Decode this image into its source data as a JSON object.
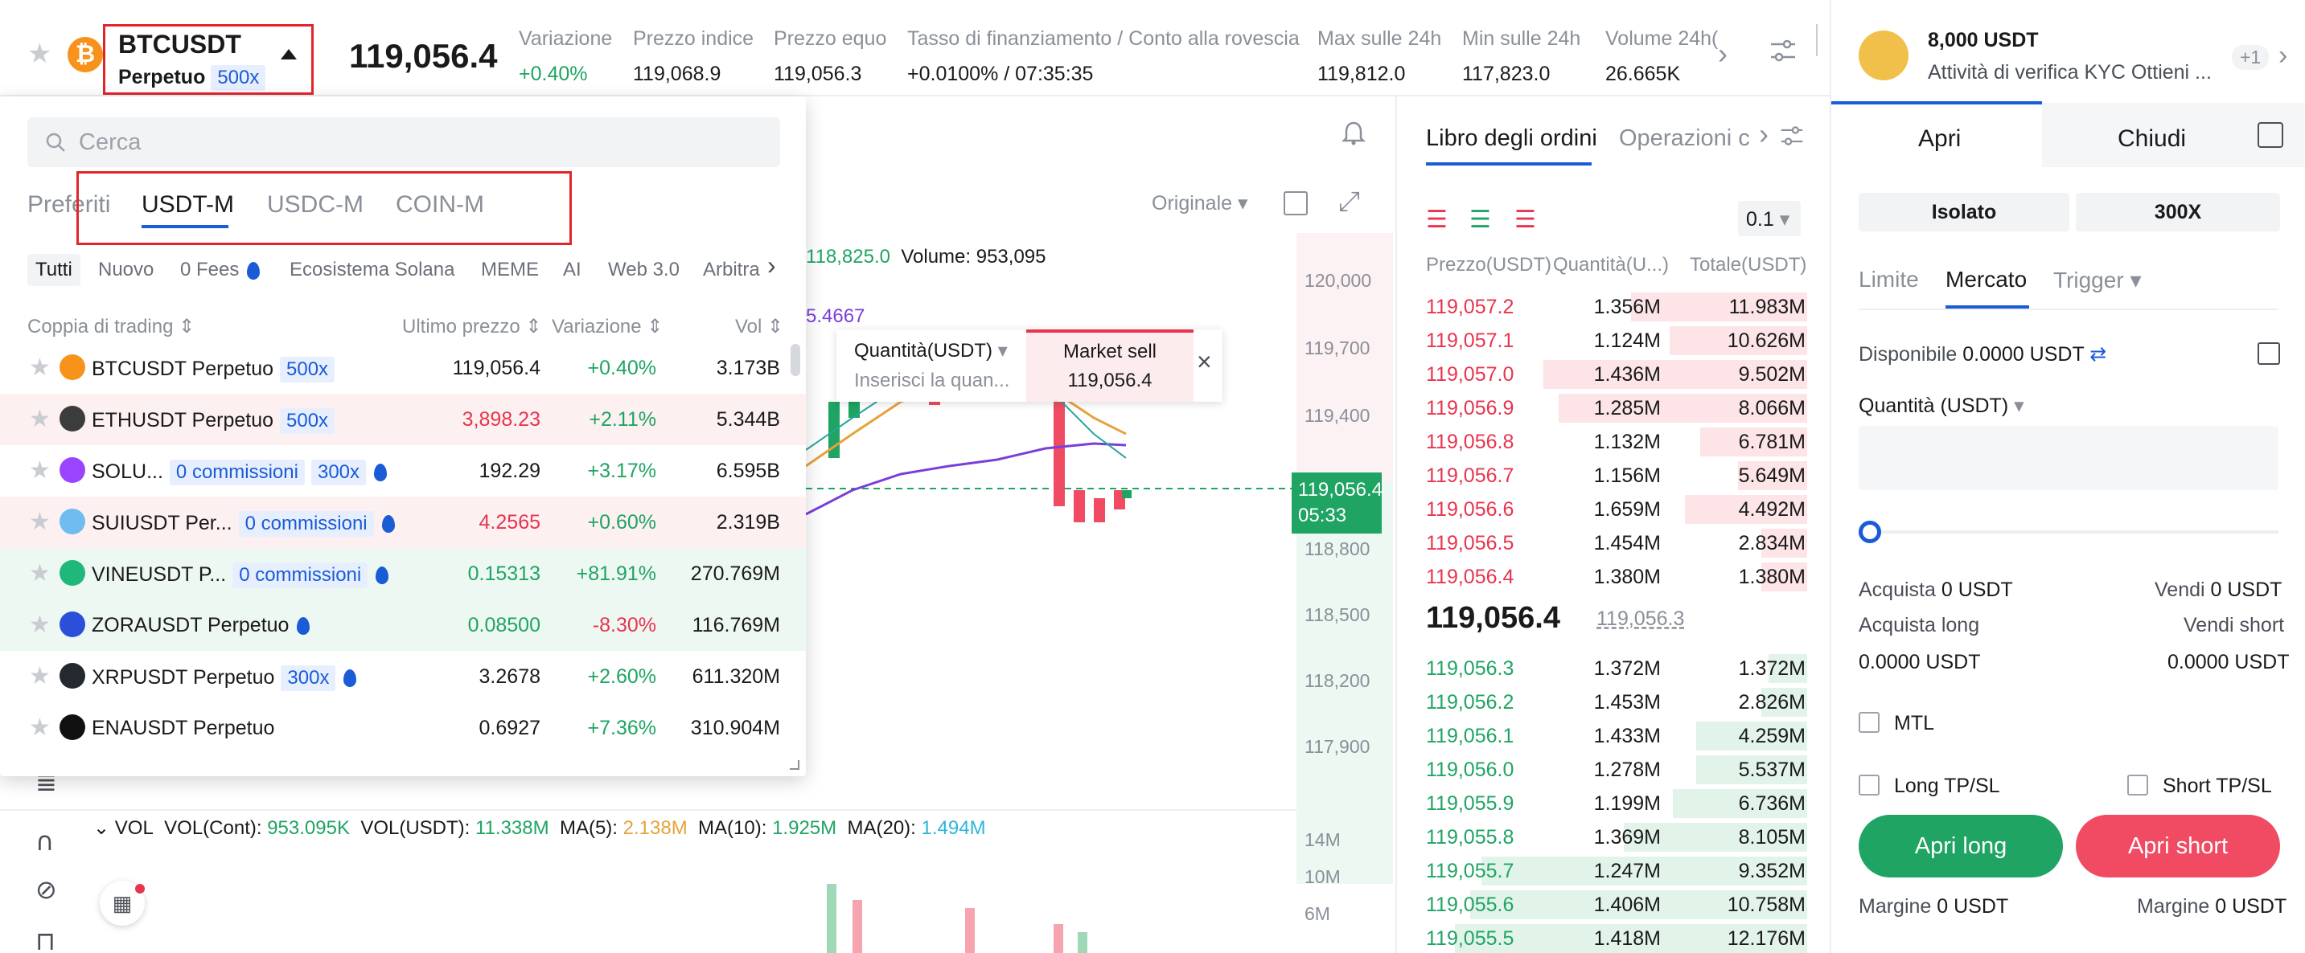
{
  "ticker": {
    "symbol": "BTCUSDT",
    "contract": "Perpetuo",
    "leverage": "500x",
    "last_price": "119,056.4",
    "stats": [
      {
        "label": "Variazione",
        "value": "+0.40%"
      },
      {
        "label": "Prezzo indice",
        "value": "119,068.9"
      },
      {
        "label": "Prezzo equo",
        "value": "119,056.3"
      },
      {
        "label": "Tasso di finanziamento",
        "label2": "Conto alla rovescia",
        "value": "+0.0100%",
        "value2": "07:35:35"
      },
      {
        "label": "Max sulle 24h",
        "value": "119,812.0"
      },
      {
        "label": "Min sulle 24h",
        "value": "117,823.0"
      },
      {
        "label": "Volume 24h(",
        "value": "26.665K"
      }
    ]
  },
  "dropdown": {
    "search_placeholder": "Cerca",
    "tabs": [
      "Preferiti",
      "USDT-M",
      "USDC-M",
      "COIN-M"
    ],
    "chips": [
      "Tutti",
      "Nuovo",
      "0 Fees",
      "Ecosistema Solana",
      "MEME",
      "AI",
      "Web 3.0",
      "Arbitra"
    ],
    "columns": [
      "Coppia di trading",
      "Ultimo prezzo",
      "Variazione",
      "Vol"
    ],
    "rows": [
      {
        "name": "BTCUSDT Perpetuo",
        "badge": "500x",
        "badge2": "",
        "price": "119,056.4",
        "change": "+0.40%",
        "vol": "3.173B",
        "price_color": "#1a1a1a",
        "change_color": "#1fa463",
        "bg": "#ffffff",
        "icon_color": "#f7931a"
      },
      {
        "name": "ETHUSDT Perpetuo",
        "badge": "500x",
        "badge2": "",
        "price": "3,898.23",
        "change": "+2.11%",
        "vol": "5.344B",
        "price_color": "#e8344e",
        "change_color": "#1fa463",
        "bg": "#fdf0f1",
        "icon_color": "#3c3c3d"
      },
      {
        "name": "SOLU...",
        "badge": "0 commissioni",
        "badge2": "300x",
        "price": "192.29",
        "change": "+3.17%",
        "vol": "6.595B",
        "price_color": "#1a1a1a",
        "change_color": "#1fa463",
        "bg": "#ffffff",
        "icon_color": "#9945ff"
      },
      {
        "name": "SUIUSDT Per...",
        "badge": "0 commissioni",
        "badge2": "",
        "price": "4.2565",
        "change": "+0.60%",
        "vol": "2.319B",
        "price_color": "#e8344e",
        "change_color": "#1fa463",
        "bg": "#fdf0f1",
        "icon_color": "#6fbcf0"
      },
      {
        "name": "VINEUSDT P...",
        "badge": "0 commissioni",
        "badge2": "",
        "price": "0.15313",
        "change": "+81.91%",
        "vol": "270.769M",
        "price_color": "#1fa463",
        "change_color": "#1fa463",
        "bg": "#eef8f3",
        "icon_color": "#1fb87a"
      },
      {
        "name": "ZORAUSDT Perpetuo",
        "badge": "",
        "badge2": "",
        "price": "0.08500",
        "change": "-8.30%",
        "vol": "116.769M",
        "price_color": "#1fa463",
        "change_color": "#e8344e",
        "bg": "#eef8f3",
        "icon_color": "#2b4fd8"
      },
      {
        "name": "XRPUSDT Perpetuo",
        "badge": "300x",
        "badge2": "",
        "price": "3.2678",
        "change": "+2.60%",
        "vol": "611.320M",
        "price_color": "#1a1a1a",
        "change_color": "#1fa463",
        "bg": "#ffffff",
        "icon_color": "#23292f"
      },
      {
        "name": "ENAUSDT Perpetuo",
        "badge": "",
        "badge2": "",
        "price": "0.6927",
        "change": "+7.36%",
        "vol": "310.904M",
        "price_color": "#1a1a1a",
        "change_color": "#1fa463",
        "bg": "#ffffff",
        "icon_color": "#111111"
      }
    ]
  },
  "chart": {
    "price_labels": [
      "120,000",
      "119,700",
      "119,400",
      "118,800",
      "118,500",
      "118,200",
      "117,900"
    ],
    "current_price": "119,056.4",
    "countdown": "05:33",
    "mode": "Originale",
    "ohlc_partial": "118,825.0",
    "volume_label": "Volume:",
    "volume_value": "953,095",
    "ma_partial": "5.4667",
    "order_popup": {
      "qty_label": "Quantità(USDT)",
      "qty_placeholder": "Inserisci la quan...",
      "side": "Market sell",
      "price": "119,056.4"
    },
    "vol_bar": {
      "label": "VOL",
      "cont_label": "VOL(Cont):",
      "cont_value": "953.095K",
      "usdt_label": "VOL(USDT):",
      "usdt_value": "11.338M",
      "ma5_label": "MA(5):",
      "ma5_value": "2.138M",
      "ma10_label": "MA(10):",
      "ma10_value": "1.925M",
      "ma20_label": "MA(20):",
      "ma20_value": "1.494M"
    },
    "vol_axis": [
      "14M",
      "10M",
      "6M"
    ]
  },
  "orderbook": {
    "tabs": [
      "Libro degli ordini",
      "Operazioni c"
    ],
    "step": "0.1",
    "headers": [
      "Prezzo(USDT)",
      "Quantità(U...)",
      "Totale(USDT)"
    ],
    "asks": [
      {
        "p": "119,057.2",
        "q": "1.356M",
        "t": "11.983M",
        "d": 0.46
      },
      {
        "p": "119,057.1",
        "q": "1.124M",
        "t": "10.626M",
        "d": 0.36
      },
      {
        "p": "119,057.0",
        "q": "1.436M",
        "t": "9.502M",
        "d": 0.69
      },
      {
        "p": "119,056.9",
        "q": "1.285M",
        "t": "8.066M",
        "d": 0.65
      },
      {
        "p": "119,056.8",
        "q": "1.132M",
        "t": "6.781M",
        "d": 0.28
      },
      {
        "p": "119,056.7",
        "q": "1.156M",
        "t": "5.649M",
        "d": 0.18
      },
      {
        "p": "119,056.6",
        "q": "1.659M",
        "t": "4.492M",
        "d": 0.32
      },
      {
        "p": "119,056.5",
        "q": "1.454M",
        "t": "2.834M",
        "d": 0.12
      },
      {
        "p": "119,056.4",
        "q": "1.380M",
        "t": "1.380M",
        "d": 0.12
      }
    ],
    "mid_price": "119,056.4",
    "mark_price": "119,056.3",
    "bids": [
      {
        "p": "119,056.3",
        "q": "1.372M",
        "t": "1.372M",
        "d": 0.1
      },
      {
        "p": "119,056.2",
        "q": "1.453M",
        "t": "2.826M",
        "d": 0.12
      },
      {
        "p": "119,056.1",
        "q": "1.433M",
        "t": "4.259M",
        "d": 0.29
      },
      {
        "p": "119,056.0",
        "q": "1.278M",
        "t": "5.537M",
        "d": 0.29
      },
      {
        "p": "119,055.9",
        "q": "1.199M",
        "t": "6.736M",
        "d": 0.35
      },
      {
        "p": "119,055.8",
        "q": "1.369M",
        "t": "8.105M",
        "d": 0.48
      },
      {
        "p": "119,055.7",
        "q": "1.247M",
        "t": "9.352M",
        "d": 0.85
      },
      {
        "p": "119,055.6",
        "q": "1.406M",
        "t": "10.758M",
        "d": 0.88
      },
      {
        "p": "119,055.5",
        "q": "1.418M",
        "t": "12.176M",
        "d": 0.92
      }
    ]
  },
  "trade": {
    "balance": "8,000 USDT",
    "kyc_text": "Attività di verifica KYC Ottieni ...",
    "badge_count": "+1",
    "tabs": [
      "Apri",
      "Chiudi"
    ],
    "margin_mode": "Isolato",
    "leverage": "300X",
    "order_types": [
      "Limite",
      "Mercato",
      "Trigger"
    ],
    "available_label": "Disponibile",
    "available_value": "0.0000 USDT",
    "qty_label": "Quantità (USDT)",
    "buy_label": "Acquista",
    "buy_value": "0 USDT",
    "sell_label": "Vendi",
    "sell_value": "0 USDT",
    "long_label": "Acquista long",
    "short_label": "Vendi short",
    "long_value": "0.0000 USDT",
    "short_value": "0.0000 USDT",
    "mtl": "MTL",
    "long_tpsl": "Long TP/SL",
    "short_tpsl": "Short TP/SL",
    "open_long": "Apri long",
    "open_short": "Apri short",
    "margin_label": "Margine",
    "margin_long": "0 USDT",
    "margin_short": "0 USDT"
  },
  "colors": {
    "up": "#1fa463",
    "down": "#e8344e",
    "accent": "#1a5bd6"
  }
}
